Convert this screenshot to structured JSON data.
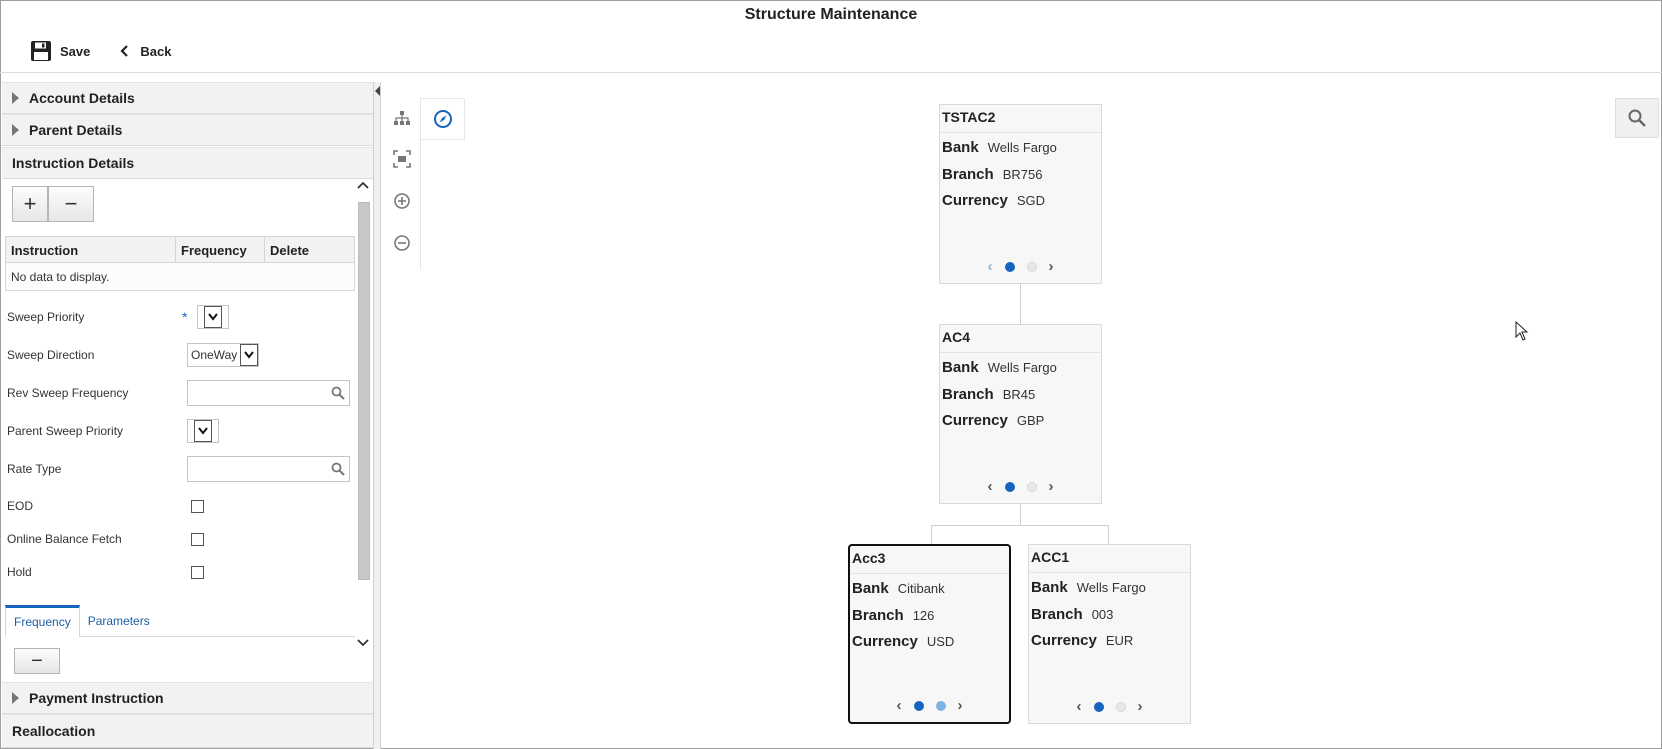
{
  "window": {
    "title": "Structure Maintenance"
  },
  "toolbar": {
    "save_label": "Save",
    "back_label": "Back"
  },
  "left_panel": {
    "sections": {
      "account_details": "Account Details",
      "parent_details": "Parent Details",
      "instruction_details": "Instruction Details",
      "payment_instruction": "Payment Instruction",
      "reallocation": "Reallocation"
    },
    "instruction_table": {
      "columns": [
        "Instruction",
        "Frequency",
        "Delete"
      ],
      "empty_text": "No data to display."
    },
    "fields": {
      "sweep_priority": {
        "label": "Sweep Priority",
        "required_mark": "*",
        "value": ""
      },
      "sweep_direction": {
        "label": "Sweep Direction",
        "value": "OneWay"
      },
      "rev_sweep_frequency": {
        "label": "Rev Sweep Frequency",
        "value": ""
      },
      "parent_sweep_priority": {
        "label": "Parent Sweep Priority",
        "value": ""
      },
      "rate_type": {
        "label": "Rate Type",
        "value": ""
      },
      "eod": {
        "label": "EOD",
        "checked": false
      },
      "online_balance_fetch": {
        "label": "Online Balance Fetch",
        "checked": false
      },
      "hold": {
        "label": "Hold",
        "checked": false
      }
    },
    "tabs": [
      {
        "label": "Frequency",
        "active": true
      },
      {
        "label": "Parameters",
        "active": false
      }
    ]
  },
  "diagram": {
    "field_labels": {
      "bank": "Bank",
      "branch": "Branch",
      "currency": "Currency"
    },
    "nodes": [
      {
        "id": "TSTAC2",
        "bank": "Wells Fargo",
        "branch": "BR756",
        "currency": "SGD",
        "selected": false
      },
      {
        "id": "AC4",
        "bank": "Wells Fargo",
        "branch": "BR45",
        "currency": "GBP",
        "selected": false
      },
      {
        "id": "Acc3",
        "bank": "Citibank",
        "branch": "126",
        "currency": "USD",
        "selected": true
      },
      {
        "id": "ACC1",
        "bank": "Wells Fargo",
        "branch": "003",
        "currency": "EUR",
        "selected": false
      }
    ]
  },
  "colors": {
    "accent": "#1565c0",
    "panel_header": "#f2f2f2",
    "node_bg": "#f7f7f7"
  }
}
